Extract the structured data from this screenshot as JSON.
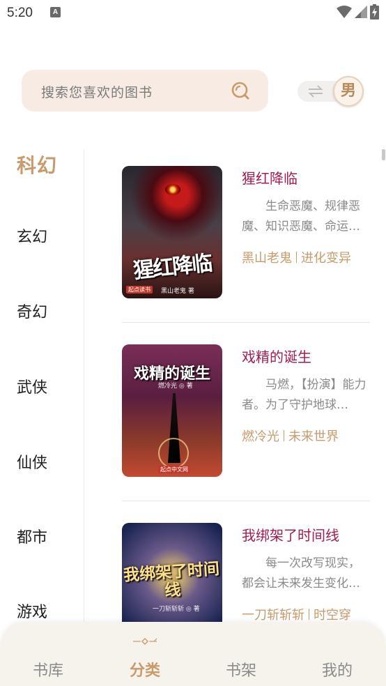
{
  "status_bar": {
    "time": "5:20",
    "notification_icon": "A"
  },
  "search": {
    "placeholder": "搜索您喜欢的图书"
  },
  "gender_toggle": {
    "label": "男"
  },
  "categories": {
    "active": "科幻",
    "items": [
      "玄幻",
      "奇幻",
      "武侠",
      "仙侠",
      "都市",
      "游戏"
    ]
  },
  "books": [
    {
      "title": "猩红降临",
      "desc": "生命恶魔、规律恶魔、知识恶魔、命运…",
      "author": "黑山老鬼",
      "tag": "进化变异",
      "cover_text": "猩红降临",
      "cover_author": "黑山老鬼 著",
      "cover_badge": "起点读书"
    },
    {
      "title": "戏精的诞生",
      "desc": "马燃，【扮演】能力者。为了守护地球…",
      "author": "燃冷光",
      "tag": "未来世界",
      "cover_text": "戏精的诞生",
      "cover_author": "燃冷光 ◎ 著",
      "cover_badge": "起点中文网"
    },
    {
      "title": "我绑架了时间线",
      "desc": "每一次改写现实，都会让未来发生变化…",
      "author": "一刀斩斩斩",
      "tag": "时空穿",
      "cover_text": "我绑架了时间线",
      "cover_author": "一刀斩斩斩 ◎ 著",
      "cover_badge": ""
    }
  ],
  "bottom_nav": {
    "items": [
      "书库",
      "分类",
      "书架",
      "我的"
    ],
    "active_index": 1
  },
  "colors": {
    "accent": "#c89a6c",
    "title": "#a21c52",
    "search_bg": "#f7ebe4",
    "nav_bg": "#f5f3ec"
  }
}
